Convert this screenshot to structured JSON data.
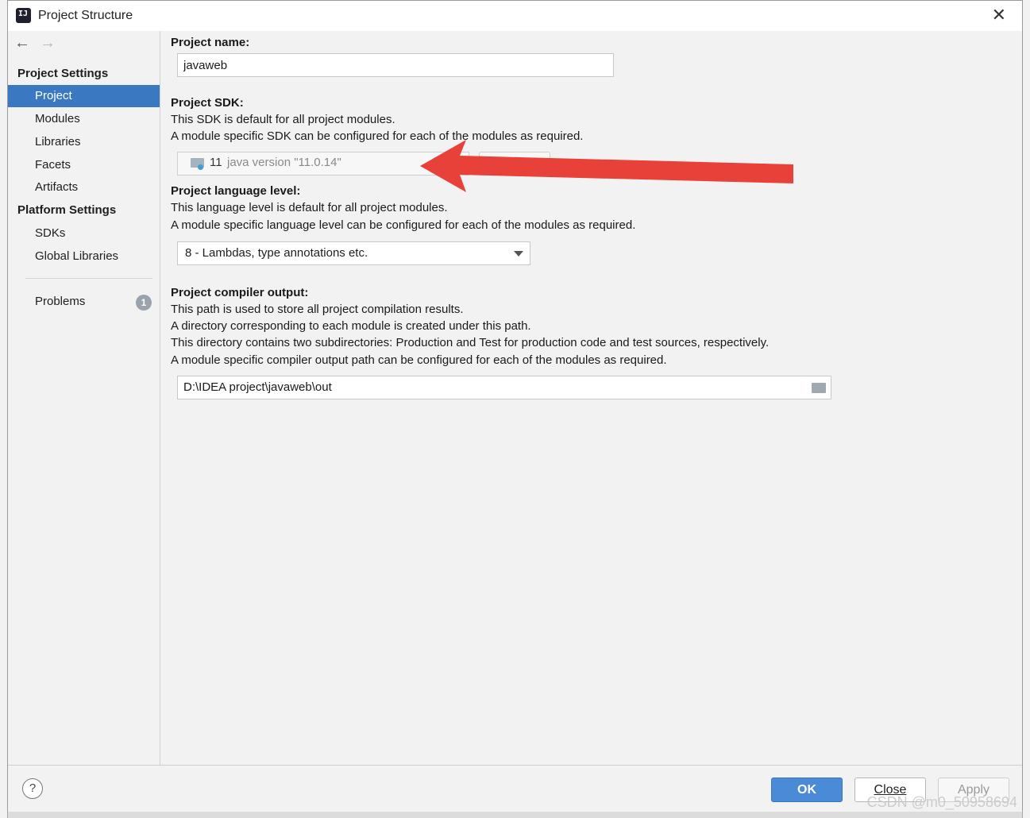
{
  "window": {
    "title": "Project Structure"
  },
  "sidebar": {
    "project_settings_header": "Project Settings",
    "project_items": [
      "Project",
      "Modules",
      "Libraries",
      "Facets",
      "Artifacts"
    ],
    "platform_settings_header": "Platform Settings",
    "platform_items": [
      "SDKs",
      "Global Libraries"
    ],
    "problems_label": "Problems",
    "problems_count": "1"
  },
  "project_name": {
    "label": "Project name:",
    "value": "javaweb"
  },
  "project_sdk": {
    "label": "Project SDK:",
    "desc1": "This SDK is default for all project modules.",
    "desc2": "A module specific SDK can be configured for each of the modules as required.",
    "sdk_number": "11",
    "sdk_version": "java version \"11.0.14\""
  },
  "language_level": {
    "label": "Project language level:",
    "desc1": "This language level is default for all project modules.",
    "desc2": "A module specific language level can be configured for each of the modules as required.",
    "selected": "8 - Lambdas, type annotations etc."
  },
  "compiler_output": {
    "label": "Project compiler output:",
    "desc1": "This path is used to store all project compilation results.",
    "desc2": "A directory corresponding to each module is created under this path.",
    "desc3": "This directory contains two subdirectories: Production and Test for production code and test sources, respectively.",
    "desc4": "A module specific compiler output path can be configured for each of the modules as required.",
    "path": "D:\\IDEA project\\javaweb\\out"
  },
  "footer": {
    "help": "?",
    "ok": "OK",
    "close": "Close",
    "apply": "Apply"
  },
  "watermark": "CSDN @m0_50958694",
  "colors": {
    "selection": "#3b78c2",
    "ok_button": "#4a8ad6",
    "arrow": "#e8413a"
  },
  "icons": [
    "app-icon",
    "back-arrow-icon",
    "forward-arrow-icon",
    "close-icon",
    "sdk-folder-icon",
    "dropdown-caret-icon",
    "folder-browse-icon",
    "help-icon"
  ]
}
